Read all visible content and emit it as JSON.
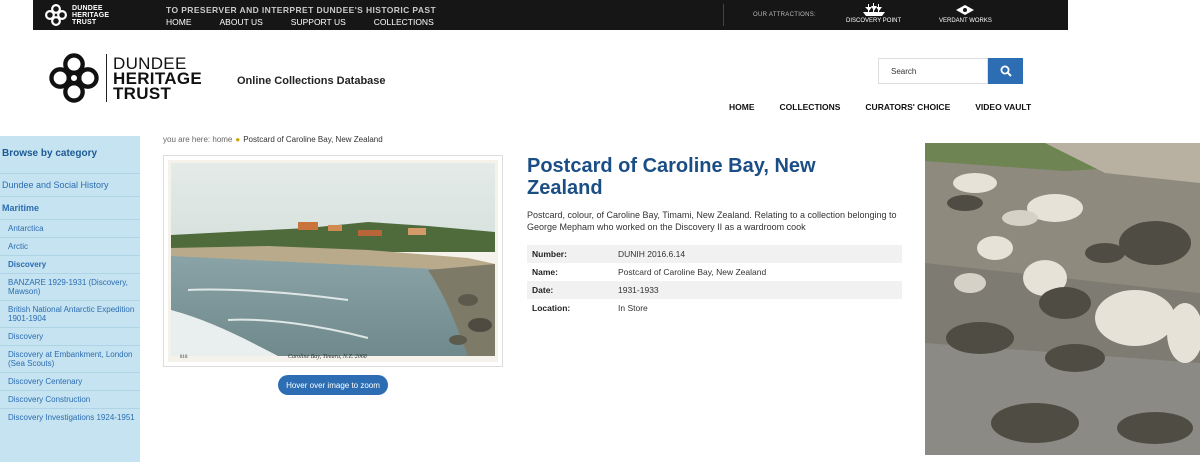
{
  "topbar": {
    "brand_line1": "DUNDEE",
    "brand_line2": "HERITAGE",
    "brand_line3": "TRUST",
    "tagline": "TO PRESERVER AND INTERPRET DUNDEE'S HISTORIC PAST",
    "nav": [
      "HOME",
      "ABOUT US",
      "SUPPORT US",
      "COLLECTIONS"
    ],
    "attractions_label": "OUR ATTRACTIONS:",
    "attractions": [
      "DISCOVERY POINT",
      "VERDANT WORKS"
    ]
  },
  "header": {
    "logo_line1": "DUNDEE",
    "logo_line2": "HERITAGE",
    "logo_line3": "TRUST",
    "db_title": "Online Collections Database",
    "search_placeholder": "Search",
    "nav": [
      "HOME",
      "COLLECTIONS",
      "CURATORS' CHOICE",
      "VIDEO VAULT"
    ]
  },
  "sidebar": {
    "heading": "Browse by category",
    "items": [
      "Dundee and Social History",
      "Maritime",
      "Antarctica",
      "Arctic",
      "Discovery",
      "BANZARE 1929-1931 (Discovery, Mawson)",
      "British National Antarctic Expedition 1901-1904",
      "Discovery",
      "Discovery at Embankment, London (Sea Scouts)",
      "Discovery Centenary",
      "Discovery Construction",
      "Discovery Investigations 1924-1951"
    ]
  },
  "breadcrumb": {
    "prefix": "you are here: home",
    "current": "Postcard of Caroline Bay, New Zealand"
  },
  "image": {
    "caption": "Caroline Bay, Timaru, N.Z. 2068",
    "number": "818",
    "zoom_label": "Hover over image to zoom"
  },
  "object": {
    "title": "Postcard of Caroline Bay, New Zealand",
    "description": "Postcard, colour, of Caroline Bay, Timami, New Zealand. Relating to a collection belonging to George Mepham who worked on the Discovery II as a wardroom cook",
    "fields": [
      {
        "label": "Number:",
        "value": "DUNIH 2016.6.14"
      },
      {
        "label": "Name:",
        "value": "Postcard of Caroline Bay, New Zealand"
      },
      {
        "label": "Date:",
        "value": "1931-1933"
      },
      {
        "label": "Location:",
        "value": "In Store"
      }
    ]
  },
  "colors": {
    "topbar_bg": "#161616",
    "accent_blue": "#2c6db3",
    "title_blue": "#1c4e86",
    "sidebar_bg": "#c5e3f0"
  }
}
